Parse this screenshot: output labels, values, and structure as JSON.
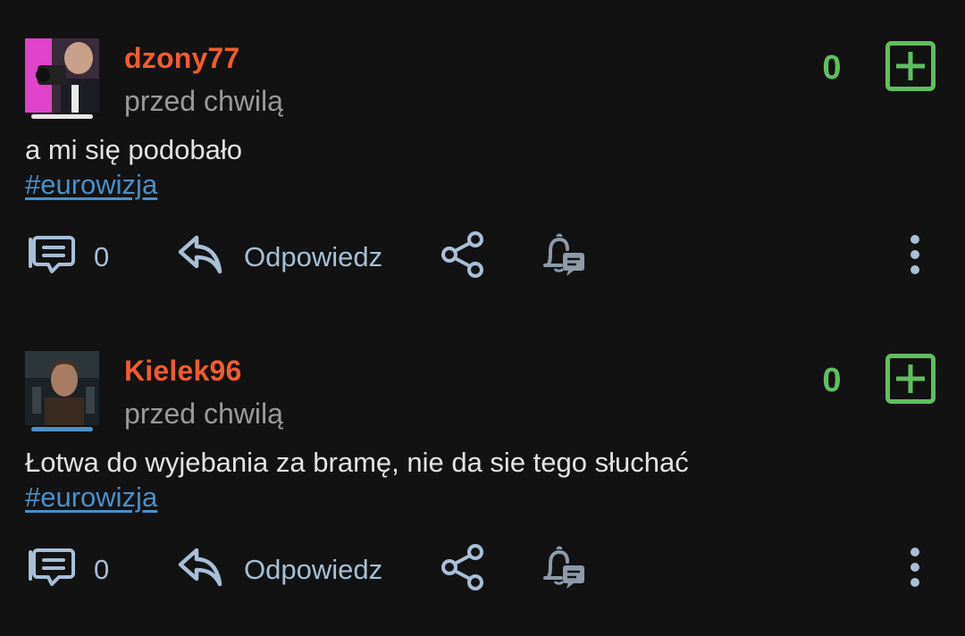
{
  "theme": {
    "accent_username": "#f45b2e",
    "vote_green": "#5fbf5f",
    "link_blue": "#4a90c8",
    "action_color": "#a8bfd6"
  },
  "posts": [
    {
      "username": "dzony77",
      "timestamp": "przed chwilą",
      "votes": "0",
      "body": "a mi się podobało",
      "tag": "#eurowizja",
      "comments": "0",
      "reply_label": "Odpowiedz",
      "avatar_underline": "#e6e6e6"
    },
    {
      "username": "Kielek96",
      "timestamp": "przed chwilą",
      "votes": "0",
      "body": "Łotwa do wyjebania za bramę, nie da sie tego słuchać",
      "tag": "#eurowizja",
      "comments": "0",
      "reply_label": "Odpowiedz",
      "avatar_underline": "#4a90c8"
    }
  ],
  "icons": {
    "vote": "plus-square-icon",
    "comments": "comment-icon",
    "reply": "reply-arrow-icon",
    "share": "share-icon",
    "bell": "bell-notification-icon",
    "more": "more-vertical-icon"
  }
}
